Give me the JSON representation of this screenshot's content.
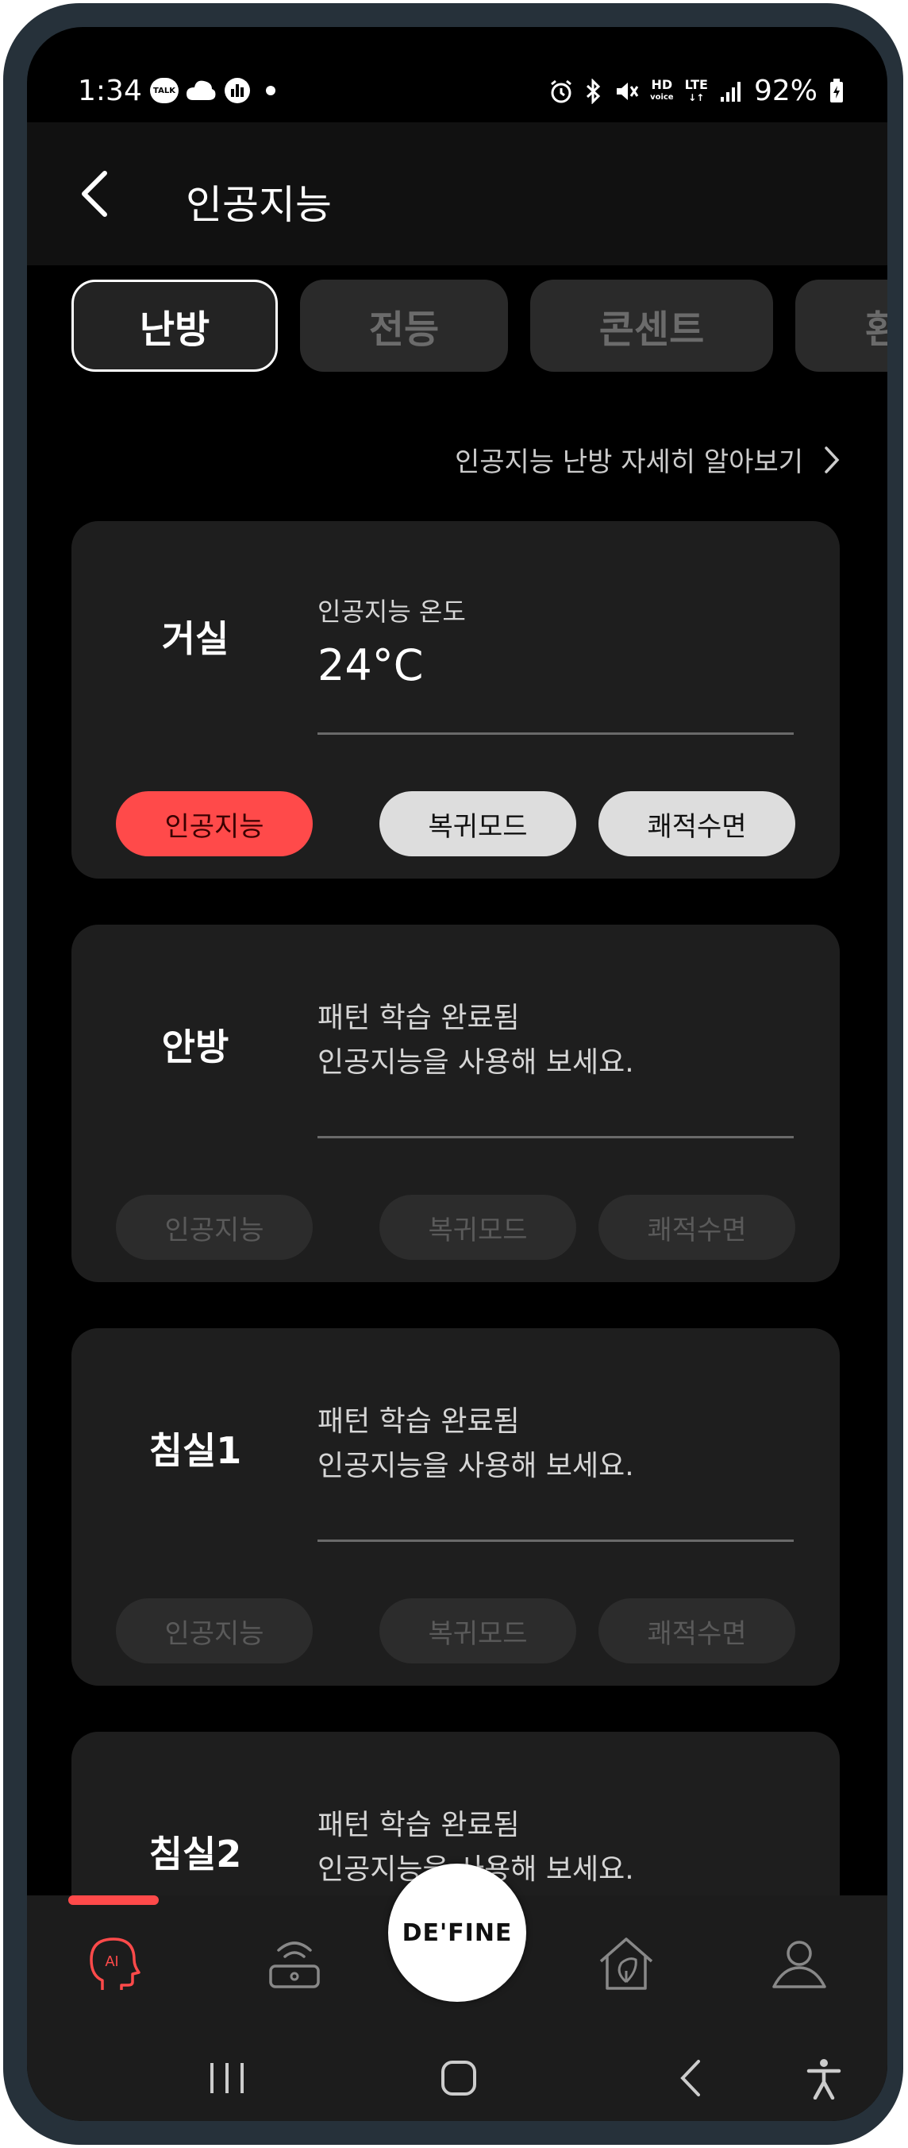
{
  "status_bar": {
    "time": "1:34",
    "talk_label": "TALK",
    "battery": "92%",
    "hd_label": "HD",
    "voice_label": "voice",
    "lte_label": "LTE"
  },
  "header": {
    "title": "인공지능"
  },
  "tabs": [
    {
      "label": "난방",
      "active": true
    },
    {
      "label": "전등",
      "active": false
    },
    {
      "label": "콘센트",
      "active": false
    },
    {
      "label": "환",
      "active": false
    }
  ],
  "learn_more": "인공지능 난방 자세히 알아보기",
  "cards": [
    {
      "room": "거실",
      "subtitle": "인공지능 온도",
      "temperature": "24°C",
      "buttons": [
        "인공지능",
        "복귀모드",
        "쾌적수면"
      ]
    },
    {
      "room": "안방",
      "line1": "패턴 학습 완료됨",
      "line2": "인공지능을 사용해 보세요.",
      "buttons": [
        "인공지능",
        "복귀모드",
        "쾌적수면"
      ]
    },
    {
      "room": "침실1",
      "line1": "패턴 학습 완료됨",
      "line2": "인공지능을 사용해 보세요.",
      "buttons": [
        "인공지능",
        "복귀모드",
        "쾌적수면"
      ]
    },
    {
      "room": "침실2",
      "line1": "패턴 학습 완료됨",
      "line2": "인공지능을 사용해 보세요."
    }
  ],
  "bottom_nav": {
    "ai_label": "AI",
    "center_logo": "DE'FINE",
    "items": [
      "ai-head-icon",
      "router-icon",
      "home-leaf-icon",
      "person-icon"
    ]
  },
  "colors": {
    "accent": "#ff4a4a",
    "card": "#1e1e1e",
    "background": "#000000"
  }
}
